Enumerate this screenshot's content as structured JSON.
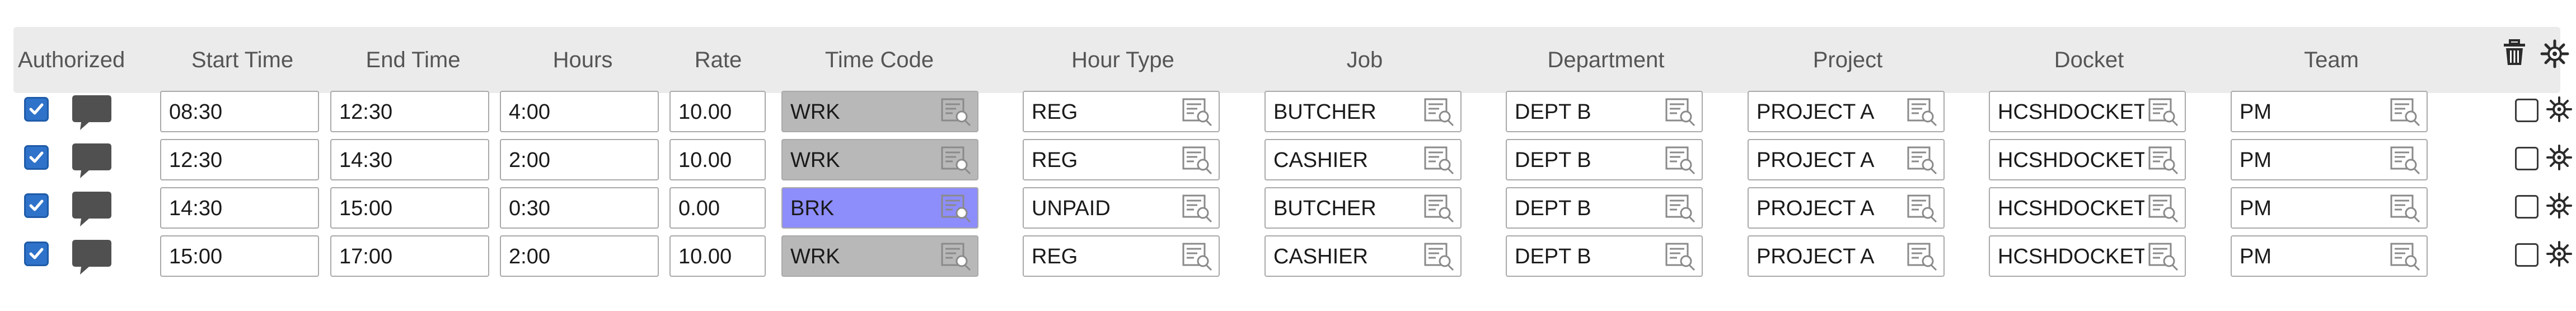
{
  "columns": {
    "authorized": "Authorized",
    "start_time": "Start Time",
    "end_time": "End Time",
    "hours": "Hours",
    "rate": "Rate",
    "time_code": "Time Code",
    "hour_type": "Hour Type",
    "job": "Job",
    "department": "Department",
    "project": "Project",
    "docket": "Docket",
    "team": "Team"
  },
  "header_icons": [
    "trash-icon",
    "gear-icon"
  ],
  "colors": {
    "checkbox": "#2f72c9",
    "time_code_default": "#b8b8b8",
    "time_code_break": "#8d8dfb",
    "header_bg": "#ebebeb"
  },
  "rows": [
    {
      "authorized": true,
      "start": "08:30",
      "end": "12:30",
      "hours": "4:00",
      "rate": "10.00",
      "time_code": "WRK",
      "hour_type": "REG",
      "job": "BUTCHER",
      "department": "DEPT B",
      "project": "PROJECT A",
      "docket": "HCSHDOCKET",
      "team": "PM",
      "selected": false
    },
    {
      "authorized": true,
      "start": "12:30",
      "end": "14:30",
      "hours": "2:00",
      "rate": "10.00",
      "time_code": "WRK",
      "hour_type": "REG",
      "job": "CASHIER",
      "department": "DEPT B",
      "project": "PROJECT A",
      "docket": "HCSHDOCKET",
      "team": "PM",
      "selected": false
    },
    {
      "authorized": true,
      "start": "14:30",
      "end": "15:00",
      "hours": "0:30",
      "rate": "0.00",
      "time_code": "BRK",
      "hour_type": "UNPAID",
      "job": "BUTCHER",
      "department": "DEPT B",
      "project": "PROJECT A",
      "docket": "HCSHDOCKET",
      "team": "PM",
      "selected": false
    },
    {
      "authorized": true,
      "start": "15:00",
      "end": "17:00",
      "hours": "2:00",
      "rate": "10.00",
      "time_code": "WRK",
      "hour_type": "REG",
      "job": "CASHIER",
      "department": "DEPT B",
      "project": "PROJECT A",
      "docket": "HCSHDOCKET",
      "team": "PM",
      "selected": false
    }
  ]
}
